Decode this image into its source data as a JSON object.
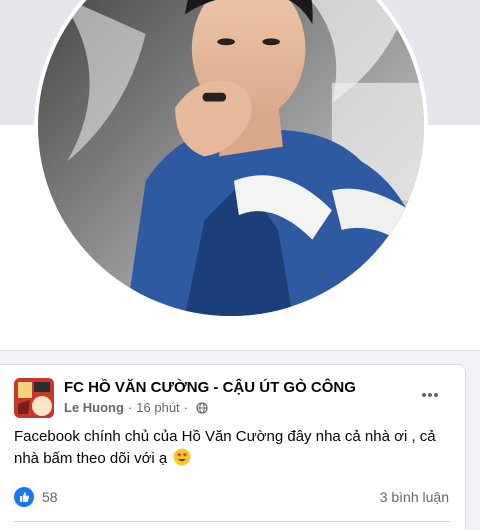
{
  "post": {
    "page_name": "FC HỒ VĂN CƯỜNG - CẬU ÚT GÒ CÔNG",
    "author": "Le Huong",
    "time": "16 phút",
    "separator": "·",
    "text": "Facebook chính chủ của Hồ Văn Cường đây nha cả nhà ơi , cả nhà bấm theo dõi với ạ",
    "reaction_count": "58",
    "comment_count": "3 bình luận"
  },
  "icons": {
    "more": "more-horizontal-icon",
    "privacy": "globe-icon",
    "like": "like-icon",
    "emoji": "heart-eyes-emoji"
  },
  "colors": {
    "like_blue": "#1877f2",
    "meta_gray": "#65676b",
    "feed_background": "#f0f2f5"
  }
}
